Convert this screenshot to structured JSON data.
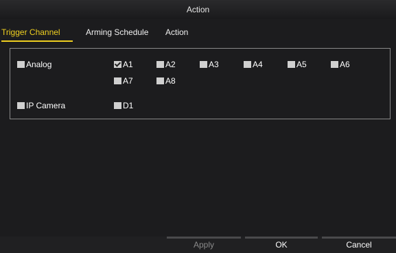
{
  "window": {
    "title": "Action"
  },
  "tabs": [
    {
      "label": "Trigger Channel",
      "active": true
    },
    {
      "label": "Arming Schedule",
      "active": false
    },
    {
      "label": "Action",
      "active": false
    }
  ],
  "groups": {
    "analog": {
      "label": "Analog",
      "checked": false,
      "channels": [
        {
          "label": "A1",
          "checked": true
        },
        {
          "label": "A2",
          "checked": false
        },
        {
          "label": "A3",
          "checked": false
        },
        {
          "label": "A4",
          "checked": false
        },
        {
          "label": "A5",
          "checked": false
        },
        {
          "label": "A6",
          "checked": false
        },
        {
          "label": "A7",
          "checked": false
        },
        {
          "label": "A8",
          "checked": false
        }
      ]
    },
    "ip_camera": {
      "label": "IP Camera",
      "checked": false,
      "channels": [
        {
          "label": "D1",
          "checked": false
        }
      ]
    }
  },
  "buttons": {
    "apply": "Apply",
    "ok": "OK",
    "cancel": "Cancel"
  },
  "colors": {
    "background": "#1c1c1e",
    "accent": "#f0d020",
    "checkbox": "#d0d0d0",
    "disabled_text": "#8a8a8a"
  }
}
